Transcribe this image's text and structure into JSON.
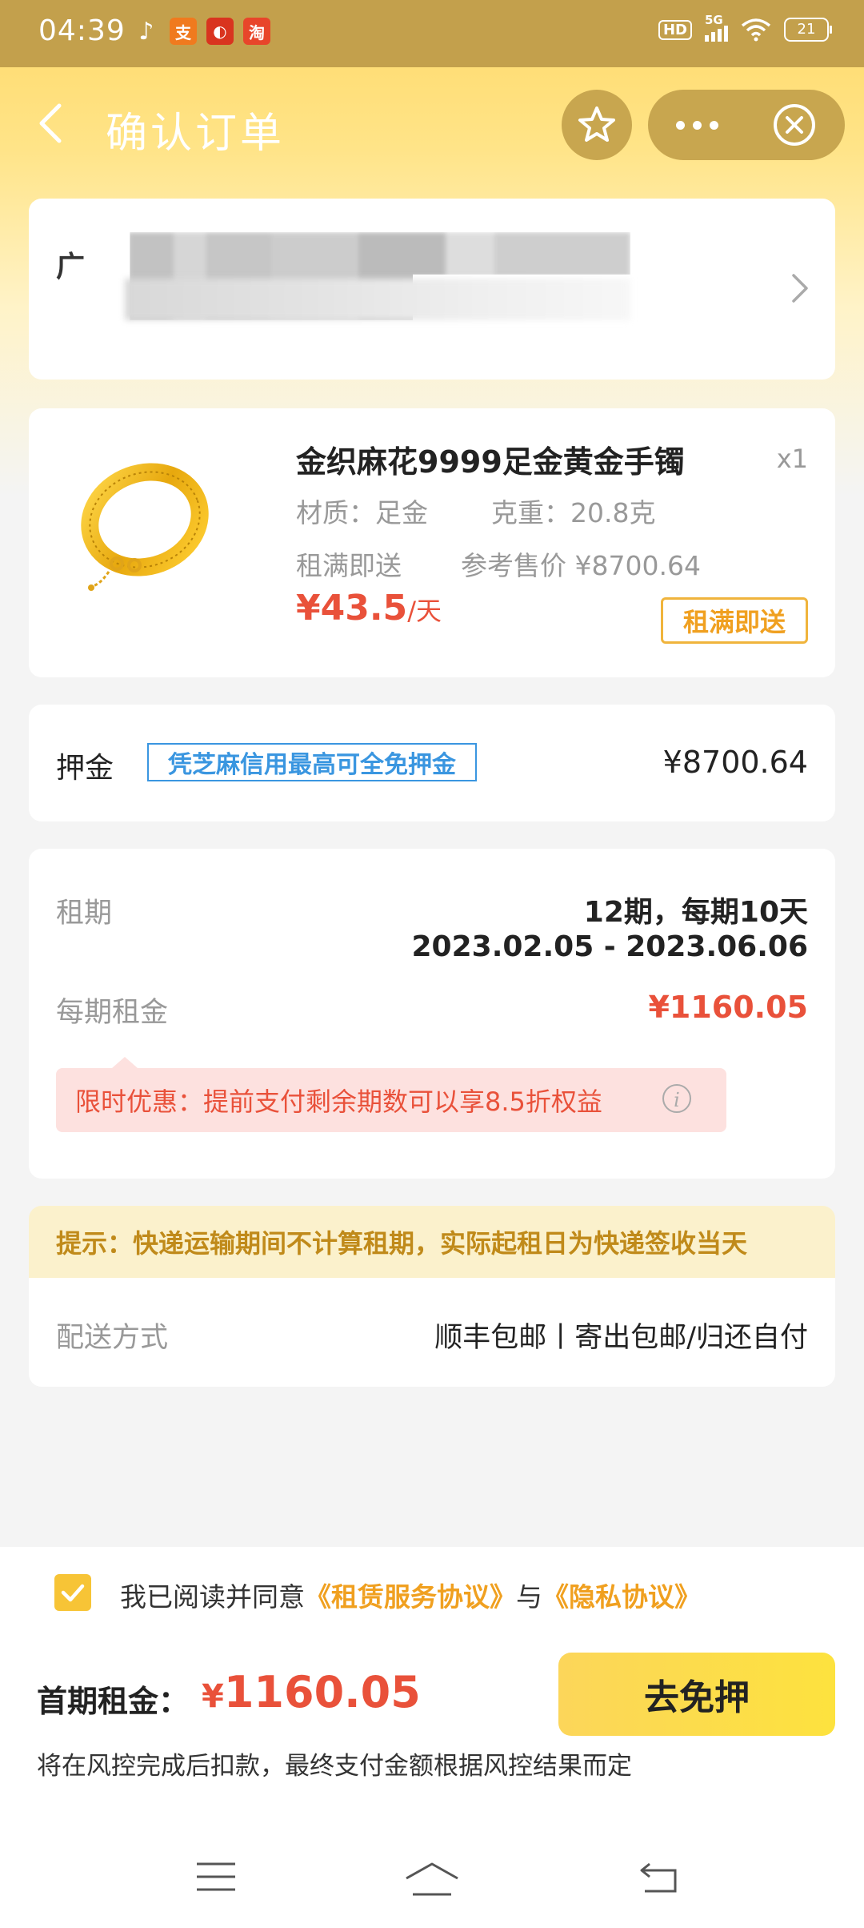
{
  "status_bar": {
    "time": "04:39",
    "hd": "HD",
    "network": "5G",
    "battery": "21"
  },
  "nav": {
    "title": "确认订单"
  },
  "address": {
    "visible_char": "广"
  },
  "product": {
    "name": "金织麻花9999足金黄金手镯",
    "qty": "x1",
    "material": "材质：足金",
    "weight": "克重：20.8克",
    "delivery": "租满即送",
    "ref_price": "参考售价 ¥8700.64",
    "price": "¥43.5",
    "price_unit": "/天",
    "tag": "租满即送"
  },
  "deposit": {
    "label": "押金",
    "badge": "凭芝麻信用最高可全免押金",
    "value": "¥8700.64"
  },
  "rent": {
    "term_label": "租期",
    "term_value": "12期，每期10天",
    "date_range": "2023.02.05 - 2023.06.06",
    "fee_label": "每期租金",
    "fee_value": "¥1160.05",
    "promo": "限时优惠：提前支付剩余期数可以享8.5折权益"
  },
  "tip": "提示：快递运输期间不计算租期，实际起租日为快递签收当天",
  "shipping": {
    "label": "配送方式",
    "value": "顺丰包邮丨寄出包邮/归还自付"
  },
  "agreement": {
    "prefix": "我已阅读并同意",
    "link1": "《租赁服务协议》",
    "mid": "与",
    "link2": "《隐私协议》",
    "checked": true
  },
  "footer": {
    "first_label": "首期租金：",
    "currency": "¥",
    "amount": "1160.05",
    "button": "去免押",
    "note": "将在风控完成后扣款，最终支付金额根据风控结果而定"
  },
  "colors": {
    "accent_red": "#e9513a",
    "accent_yellow": "#f7c436",
    "link_blue": "#3a96e0"
  }
}
